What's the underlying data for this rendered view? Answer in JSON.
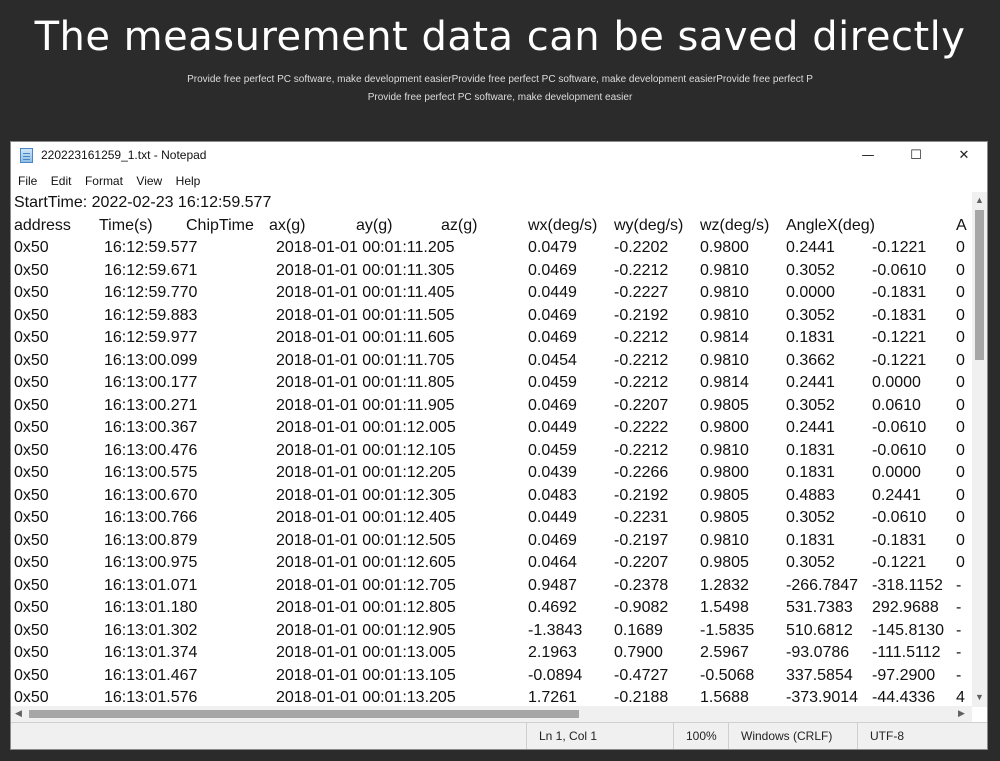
{
  "banner": {
    "headline": "The measurement data can be saved directly",
    "subline1": "Provide free perfect PC software, make development easierProvide free perfect PC software, make development easierProvide free perfect P",
    "subline2": "Provide free perfect PC software, make development easier"
  },
  "window": {
    "title": "220223161259_1.txt - Notepad",
    "controls": {
      "minimize": "—",
      "maximize": "☐",
      "close": "✕"
    }
  },
  "menu": [
    "File",
    "Edit",
    "Format",
    "View",
    "Help"
  ],
  "document": {
    "start_line": "StartTime: 2022-02-23 16:12:59.577",
    "headers": [
      "address",
      "Time(s)",
      "ChipTime",
      "ax(g)",
      "ay(g)",
      "az(g)",
      "wx(deg/s)",
      "wy(deg/s)",
      "wz(deg/s)",
      "AngleX(deg)",
      "A"
    ],
    "rows": [
      [
        "0x50",
        "16:12:59.577",
        "2018-01-01 00:01:11.205",
        "0.0479",
        "-0.2202",
        "0.9800",
        "0.2441",
        "-0.1221",
        "0"
      ],
      [
        "0x50",
        "16:12:59.671",
        "2018-01-01 00:01:11.305",
        "0.0469",
        "-0.2212",
        "0.9810",
        "0.3052",
        "-0.0610",
        "0"
      ],
      [
        "0x50",
        "16:12:59.770",
        "2018-01-01 00:01:11.405",
        "0.0449",
        "-0.2227",
        "0.9810",
        "0.0000",
        "-0.1831",
        "0"
      ],
      [
        "0x50",
        "16:12:59.883",
        "2018-01-01 00:01:11.505",
        "0.0469",
        "-0.2192",
        "0.9810",
        "0.3052",
        "-0.1831",
        "0"
      ],
      [
        "0x50",
        "16:12:59.977",
        "2018-01-01 00:01:11.605",
        "0.0469",
        "-0.2212",
        "0.9814",
        "0.1831",
        "-0.1221",
        "0"
      ],
      [
        "0x50",
        "16:13:00.099",
        "2018-01-01 00:01:11.705",
        "0.0454",
        "-0.2212",
        "0.9810",
        "0.3662",
        "-0.1221",
        "0"
      ],
      [
        "0x50",
        "16:13:00.177",
        "2018-01-01 00:01:11.805",
        "0.0459",
        "-0.2212",
        "0.9814",
        "0.2441",
        "0.0000",
        "0"
      ],
      [
        "0x50",
        "16:13:00.271",
        "2018-01-01 00:01:11.905",
        "0.0469",
        "-0.2207",
        "0.9805",
        "0.3052",
        "0.0610",
        "0"
      ],
      [
        "0x50",
        "16:13:00.367",
        "2018-01-01 00:01:12.005",
        "0.0449",
        "-0.2222",
        "0.9800",
        "0.2441",
        "-0.0610",
        "0"
      ],
      [
        "0x50",
        "16:13:00.476",
        "2018-01-01 00:01:12.105",
        "0.0459",
        "-0.2212",
        "0.9810",
        "0.1831",
        "-0.0610",
        "0"
      ],
      [
        "0x50",
        "16:13:00.575",
        "2018-01-01 00:01:12.205",
        "0.0439",
        "-0.2266",
        "0.9800",
        "0.1831",
        "0.0000",
        "0"
      ],
      [
        "0x50",
        "16:13:00.670",
        "2018-01-01 00:01:12.305",
        "0.0483",
        "-0.2192",
        "0.9805",
        "0.4883",
        "0.2441",
        "0"
      ],
      [
        "0x50",
        "16:13:00.766",
        "2018-01-01 00:01:12.405",
        "0.0449",
        "-0.2231",
        "0.9805",
        "0.3052",
        "-0.0610",
        "0"
      ],
      [
        "0x50",
        "16:13:00.879",
        "2018-01-01 00:01:12.505",
        "0.0469",
        "-0.2197",
        "0.9810",
        "0.1831",
        "-0.1831",
        "0"
      ],
      [
        "0x50",
        "16:13:00.975",
        "2018-01-01 00:01:12.605",
        "0.0464",
        "-0.2207",
        "0.9805",
        "0.3052",
        "-0.1221",
        "0"
      ],
      [
        "0x50",
        "16:13:01.071",
        "2018-01-01 00:01:12.705",
        "0.9487",
        "-0.2378",
        "1.2832",
        "-266.7847",
        "-318.1152",
        "-"
      ],
      [
        "0x50",
        "16:13:01.180",
        "2018-01-01 00:01:12.805",
        "0.4692",
        "-0.9082",
        "1.5498",
        "531.7383",
        "292.9688",
        "-"
      ],
      [
        "0x50",
        "16:13:01.302",
        "2018-01-01 00:01:12.905",
        "-1.3843",
        "0.1689",
        "-1.5835",
        "510.6812",
        "-145.8130",
        "-"
      ],
      [
        "0x50",
        "16:13:01.374",
        "2018-01-01 00:01:13.005",
        "2.1963",
        "0.7900",
        "2.5967",
        "-93.0786",
        "-111.5112",
        "-"
      ],
      [
        "0x50",
        "16:13:01.467",
        "2018-01-01 00:01:13.105",
        "-0.0894",
        "-0.4727",
        "-0.5068",
        "337.5854",
        "-97.2900",
        "-"
      ],
      [
        "0x50",
        "16:13:01.576",
        "2018-01-01 00:01:13.205",
        "1.7261",
        "-0.2188",
        "1.5688",
        "-373.9014",
        "-44.4336",
        "4"
      ]
    ]
  },
  "status": {
    "position": "Ln 1, Col 1",
    "zoom": "100%",
    "line_ending": "Windows (CRLF)",
    "encoding": "UTF-8"
  }
}
